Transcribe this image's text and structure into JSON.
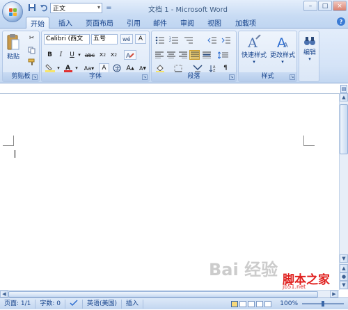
{
  "window": {
    "title": "文档 1 - Microsoft Word",
    "minimize": "–",
    "maximize": "□",
    "close": "×"
  },
  "quick_access": {
    "style_value": "正文",
    "more": "="
  },
  "tabs": [
    "开始",
    "插入",
    "页面布局",
    "引用",
    "邮件",
    "审阅",
    "视图",
    "加载项"
  ],
  "ribbon": {
    "clipboard": {
      "label": "剪贴板",
      "paste": "粘贴"
    },
    "font": {
      "label": "字体",
      "font_name": "Calibri (西文",
      "font_size": "五号"
    },
    "paragraph": {
      "label": "段落"
    },
    "styles": {
      "label": "样式",
      "quick_styles": "快速样式",
      "change_styles": "更改样式"
    },
    "editing": {
      "label": "编辑"
    }
  },
  "status": {
    "page": "页面: 1/1",
    "words": "字数: 0",
    "language": "英语(美国)",
    "mode": "插入",
    "zoom": "100%"
  },
  "watermark": {
    "text": "Bai 经验",
    "brand": "脚本之家",
    "site": "jb51.net"
  },
  "colors": {
    "ribbon_bg": "#dbe7f7",
    "label_text": "#15428b",
    "highlight": "#f7e56b",
    "font_color": "#e03030"
  }
}
